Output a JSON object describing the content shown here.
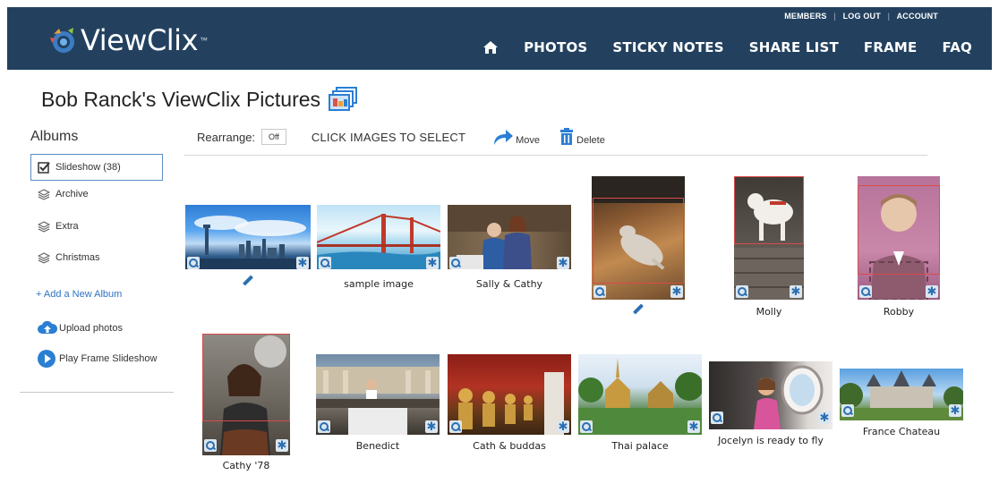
{
  "header": {
    "logo_text": "ViewClix",
    "logo_tm": "™",
    "top_links": [
      "MEMBERS",
      "LOG OUT",
      "ACCOUNT"
    ],
    "separator": "|",
    "nav": [
      "PHOTOS",
      "STICKY NOTES",
      "SHARE LIST",
      "FRAME",
      "FAQ"
    ]
  },
  "page": {
    "title": "Bob Ranck's ViewClix Pictures"
  },
  "sidebar": {
    "heading": "Albums",
    "albums": [
      "Slideshow (38)",
      "Archive",
      "Extra",
      "Christmas"
    ],
    "add_album": "+ Add a New Album",
    "upload": "Upload photos",
    "play": "Play Frame Slideshow"
  },
  "toolbar": {
    "rearrange_label": "Rearrange:",
    "toggle_value": "Off",
    "click_select": "CLICK IMAGES TO SELECT",
    "move": "Move",
    "delete": "Delete"
  },
  "gallery": {
    "captions": [
      "sample image",
      "Sally & Cathy",
      "Molly",
      "Robby",
      "Cathy '78",
      "Benedict",
      "Cath & buddas",
      "Thai palace",
      "Jocelyn is ready to fly",
      "France Chateau"
    ]
  },
  "colors": {
    "header_bg": "#23415f",
    "accent": "#2b7fd3",
    "link": "#2d73c4"
  }
}
